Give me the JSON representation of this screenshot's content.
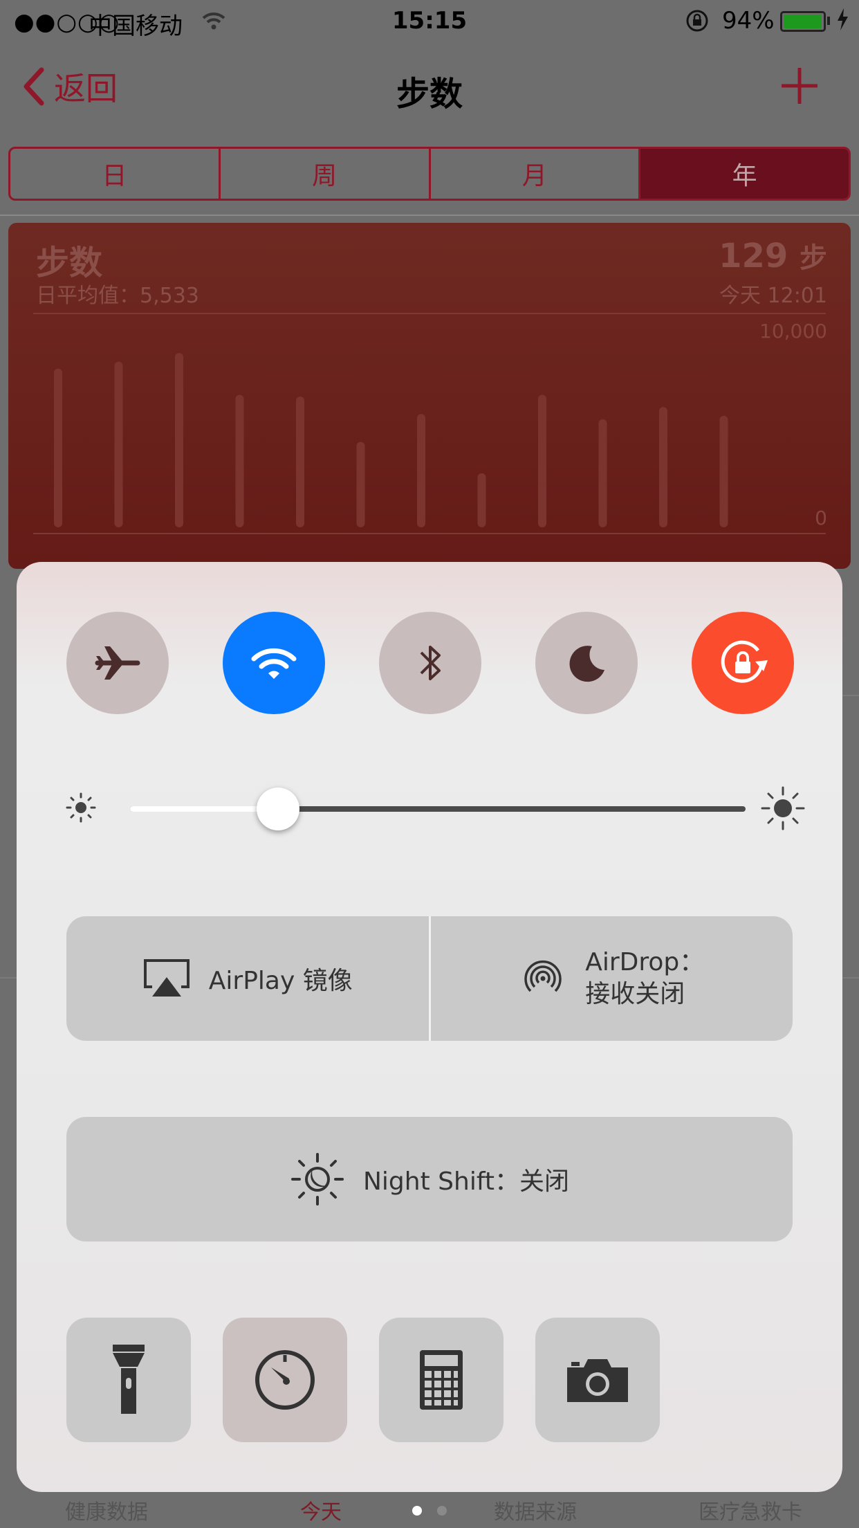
{
  "status_bar": {
    "signal": "●●○○○",
    "carrier": "中国移动",
    "time": "15:15",
    "battery_percent": "94%",
    "battery_level": 0.94,
    "icons": [
      "wifi-icon",
      "rotation-lock-icon",
      "battery-icon",
      "charging-bolt-icon"
    ]
  },
  "nav": {
    "back_label": "返回",
    "title": "步数",
    "add_icon": "plus-icon"
  },
  "segments": [
    "日",
    "周",
    "月",
    "年"
  ],
  "selected_segment": "年",
  "card": {
    "title": "步数",
    "average": "日平均值：5,533",
    "value": "129",
    "unit": "步",
    "timestamp": "今天 12:01",
    "y_max_label": "10,000",
    "y_min_label": "0"
  },
  "chart_data": {
    "type": "bar",
    "ylim": [
      0,
      10000
    ],
    "values": [
      9100,
      9500,
      10000,
      7600,
      7500,
      4900,
      6500,
      3100,
      7600,
      6200,
      6900,
      6400
    ]
  },
  "control_center": {
    "toggles": [
      {
        "name": "airplane-mode",
        "icon": "airplane-icon",
        "on": false
      },
      {
        "name": "wifi",
        "icon": "wifi-icon",
        "on": true
      },
      {
        "name": "bluetooth",
        "icon": "bluetooth-icon",
        "on": false
      },
      {
        "name": "do-not-disturb",
        "icon": "moon-icon",
        "on": false
      },
      {
        "name": "rotation-lock",
        "icon": "rotation-lock-icon",
        "on": true
      }
    ],
    "brightness_level": 0.24,
    "airplay_label": "AirPlay 镜像",
    "airdrop_line1": "AirDrop：",
    "airdrop_line2": "接收关闭",
    "night_shift_label": "Night Shift：关闭",
    "tools": [
      "flashlight-icon",
      "timer-icon",
      "calculator-icon",
      "camera-icon"
    ],
    "colors": {
      "wifi_on": "#0a7afe",
      "rotation_lock_on": "#fb4c2e"
    }
  },
  "tab_bar": {
    "items": [
      "健康数据",
      "今天",
      "数据来源",
      "医疗急救卡"
    ],
    "active": "今天",
    "page_dots": 2,
    "current_page": 1
  }
}
